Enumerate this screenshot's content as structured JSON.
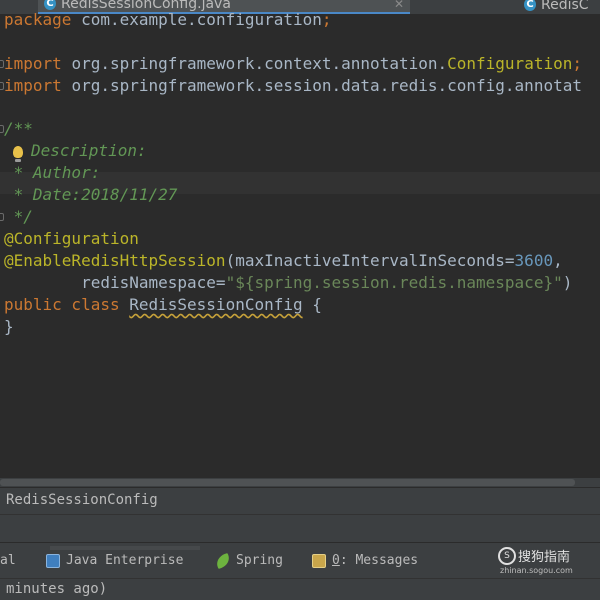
{
  "tabs": [
    {
      "label": "RedisSessionConfig.java",
      "icon": "class-file-icon",
      "icon_glyph": "C",
      "active": true
    },
    {
      "label": "RedisC",
      "icon": "class-file-icon",
      "icon_glyph": "C",
      "active": false
    }
  ],
  "editor": {
    "package_kw": "package",
    "package_name": "com.example.configuration",
    "package_semi": ";",
    "import1_kw": "import",
    "import1_path": "org.springframework.context.annotation.",
    "import1_class": "Configuration",
    "import1_semi": ";",
    "import2_kw": "import",
    "import2_path": "org.springframework.session.data.redis.config.annotat",
    "doc_open": "/**",
    "doc_desc": "Description:",
    "doc_author": " * Author:",
    "doc_date": " * Date:2018/11/27",
    "doc_close": " */",
    "ann_configuration": "@Configuration",
    "ann_redis": "@EnableRedisHttpSession",
    "ann_redis_open": "(maxInactiveIntervalInSeconds=",
    "interval_value": "3600",
    "ann_redis_comma": ",",
    "namespace_indent": "        redisNamespace=",
    "namespace_value": "\"${spring.session.redis.namespace}\"",
    "namespace_close": ")",
    "class_kw": "public class",
    "class_name": "RedisSessionConfig",
    "class_open": " {",
    "class_close": "}"
  },
  "breadcrumb": "RedisSessionConfig",
  "tool_windows": [
    {
      "label": "al"
    },
    {
      "label": "Java Enterprise",
      "icon": "java-enterprise-icon"
    },
    {
      "label": "Spring",
      "icon": "spring-icon"
    },
    {
      "mnemonic": "0",
      "label": ": Messages",
      "icon": "messages-icon"
    }
  ],
  "watermark": {
    "title": "搜狗指南",
    "url": "zhinan.sogou.com",
    "logo": "S"
  },
  "status": " minutes ago)",
  "colors": {
    "background": "#2b2b2b",
    "keyword": "#cc7832",
    "annotation": "#bbb529",
    "doc_comment": "#629755",
    "number": "#6897bb",
    "string": "#6a8759",
    "accent": "#4a88c7"
  }
}
